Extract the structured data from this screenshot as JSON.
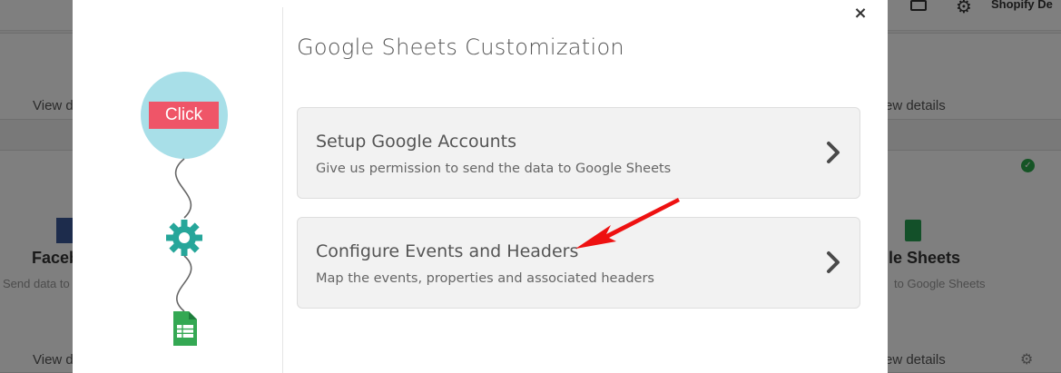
{
  "background": {
    "store_name": "Shopify De",
    "cards": [
      {
        "view_left": "View d",
        "view_right": "ew details"
      },
      {
        "title_left": "Faceb",
        "desc_left": "Send data to",
        "title_right": "gle Sheets",
        "desc_right": "to Google Sheets",
        "view_left": "View d",
        "view_right": "ew details"
      }
    ]
  },
  "modal": {
    "close_label": "×",
    "illustration": {
      "click_label": "Click"
    },
    "title": "Google Sheets Customization",
    "options": [
      {
        "title": "Setup Google Accounts",
        "description": "Give us permission to send the data to Google Sheets"
      },
      {
        "title": "Configure Events and Headers",
        "description": "Map the events, properties and associated headers"
      }
    ]
  },
  "colors": {
    "accent_red": "#ef5568",
    "bubble_blue": "#a8dfe8",
    "gear_teal": "#26a69a",
    "sheets_green": "#34a853",
    "arrow_red": "#ee1111"
  }
}
